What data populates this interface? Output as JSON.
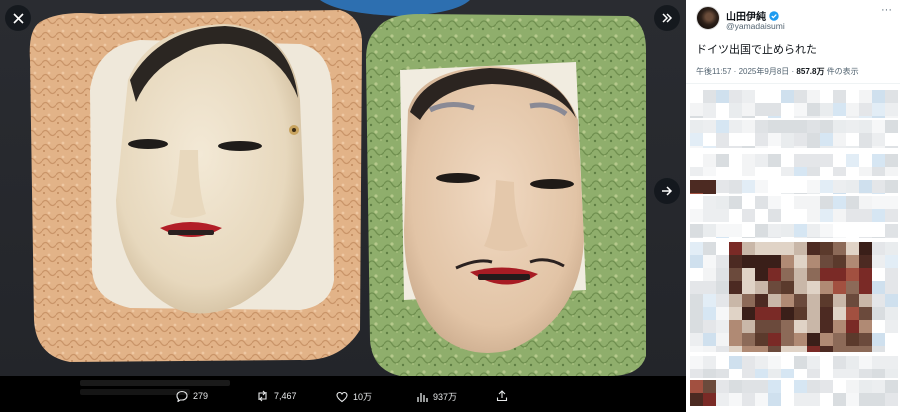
{
  "viewer": {
    "close_icon": "close-icon",
    "expand_icon": "expand-icon",
    "next_icon": "next-arrow-icon",
    "image_subject": "two noh masks on brocade cushions"
  },
  "actions": {
    "reply_count": "279",
    "repost_count": "7,467",
    "like_count": "10万",
    "views_count": "937万"
  },
  "tweet": {
    "author_name": "山田伊純",
    "handle": "@yamadaisumi",
    "text": "ドイツ出国で止められた",
    "time": "午後11:57",
    "date": "2025年9月8日",
    "views_value": "857.8万",
    "views_suffix": "件の表示",
    "separator": "·"
  },
  "colors": {
    "verified": "#1d9bf0",
    "text_primary": "#0f1419",
    "text_secondary": "#536471"
  }
}
